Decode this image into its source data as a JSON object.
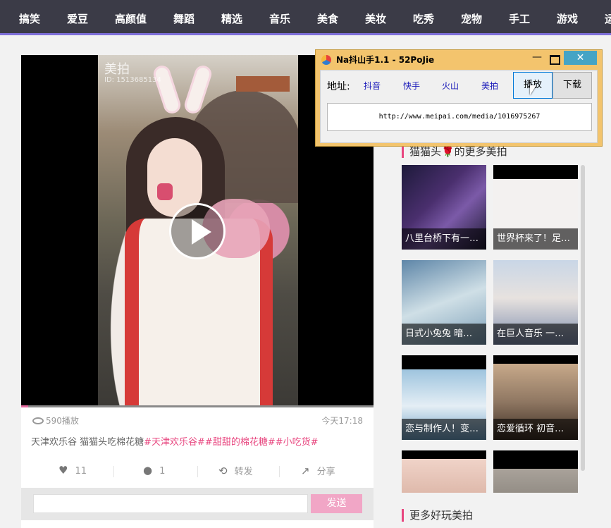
{
  "nav": {
    "items": [
      "搞笑",
      "爱豆",
      "高颜值",
      "舞蹈",
      "精选",
      "音乐",
      "美食",
      "美妆",
      "吃秀",
      "宠物",
      "手工",
      "游戏",
      "运"
    ]
  },
  "video": {
    "watermark": "美拍",
    "watermark_id": "ID: 1513685134",
    "progress": 0.02
  },
  "info": {
    "views": "590播放",
    "time": "今天17:18",
    "desc_plain": "天津欢乐谷 猫猫头吃棉花糖",
    "desc_tags": "#天津欢乐谷##甜甜的棉花糖##小吃货#",
    "likes": "11",
    "comments": "1",
    "repost": "转发",
    "share": "分享",
    "comment_placeholder": "",
    "send_label": "发送"
  },
  "sidebar": {
    "more_title": "猫猫头🌹的更多美拍",
    "fun_title": "更多好玩美拍",
    "thumbs": [
      "八里台桥下有一…",
      "世界杯来了！足…",
      "日式小兔兔 暗…",
      "在巨人音乐 一…",
      "恋与制作人！变…",
      "恋爱循环 初音…",
      "",
      ""
    ]
  },
  "tool": {
    "title": "Na抖山手1.1 - 52PoJie",
    "address_label": "地址:",
    "platforms": [
      "抖音",
      "快手",
      "火山",
      "美拍"
    ],
    "play_label": "播放",
    "download_label": "下载",
    "url": "http://www.meipai.com/media/1016975267",
    "minimize": "—",
    "close": "✕"
  },
  "colors": {
    "nav_bg": "#3b3b47",
    "accent_pink": "#e8467f",
    "send_button": "#f1a6c6",
    "tool_frame": "#f3c46d",
    "tool_close": "#45a4c5",
    "link_blue": "#1515b8"
  }
}
